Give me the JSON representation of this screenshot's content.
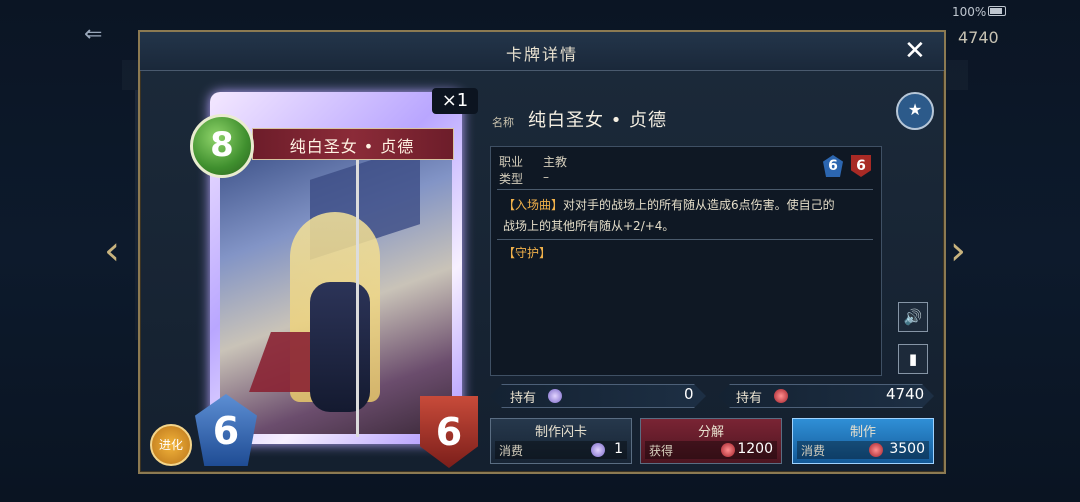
{
  "status": {
    "battery": "100%"
  },
  "background": {
    "back_glyph": "⇐",
    "coins": "4740"
  },
  "modal": {
    "title": "卡牌详情",
    "close_glyph": "✕"
  },
  "card": {
    "cost": "8",
    "copies": "×1",
    "name_plate": "纯白圣女 • 贞德",
    "attack": "6",
    "defense": "6",
    "evolve_label": "进化"
  },
  "info": {
    "name_label": "名称",
    "name": "纯白圣女 • 贞德",
    "class_label": "职业",
    "class_value": "主教",
    "type_label": "类型",
    "type_value": "–",
    "evolved_attack": "6",
    "evolved_defense": "6",
    "effect_keyword": "【入场曲】",
    "effect_text_1": "对对手的战场上的所有随从造成6点伤害。使自己的",
    "effect_text_2": "战场上的其他所有随从+2/+4。",
    "guard_keyword": "【守护】"
  },
  "owned": [
    {
      "label": "持有",
      "value": "0"
    },
    {
      "label": "持有",
      "value": "4740"
    }
  ],
  "actions": [
    {
      "title": "制作闪卡",
      "sub": "消费",
      "value": "1"
    },
    {
      "title": "分解",
      "sub": "获得",
      "value": "1200"
    },
    {
      "title": "制作",
      "sub": "消费",
      "value": "3500"
    }
  ],
  "colors": {
    "accent_gold": "#8c7a52",
    "craft_blue": "#1c6fb0",
    "dismantle_red": "#6a1f2c"
  }
}
